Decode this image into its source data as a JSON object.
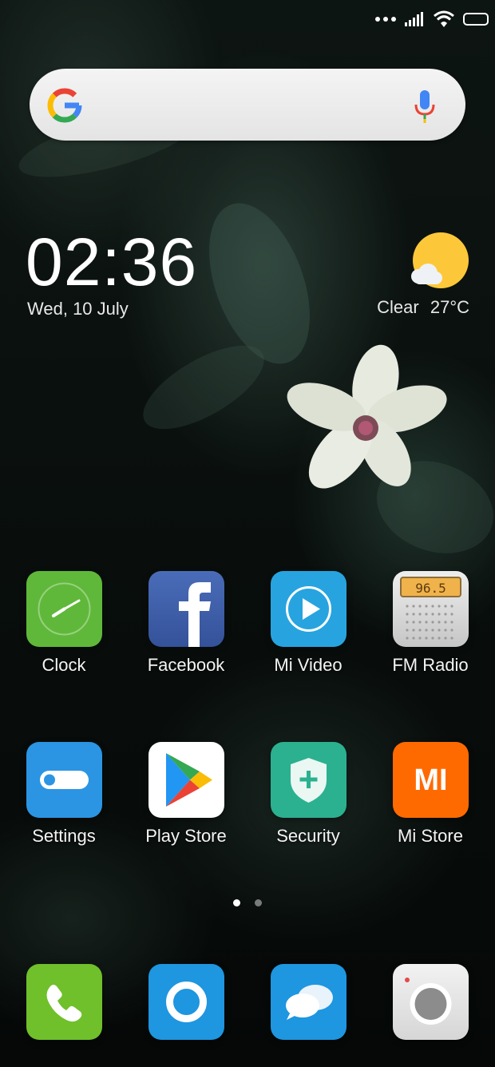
{
  "status_bar": {
    "signal_icon": "signal-icon",
    "wifi_icon": "wifi-icon",
    "battery_icon": "battery-icon"
  },
  "search_bar": {
    "logo_icon": "google-g-icon",
    "mic_icon": "microphone-icon"
  },
  "clock_widget": {
    "time": "02:36",
    "date": "Wed, 10 July"
  },
  "weather_widget": {
    "condition": "Clear",
    "temperature": "27°C",
    "icon": "sun-cloud-icon"
  },
  "apps": [
    {
      "label": "Clock",
      "icon": "clock-icon",
      "color": "#5fb83a"
    },
    {
      "label": "Facebook",
      "icon": "facebook-icon",
      "color": "#3b5ba5"
    },
    {
      "label": "Mi Video",
      "icon": "play-icon",
      "color": "#27a4e0"
    },
    {
      "label": "FM Radio",
      "icon": "radio-icon",
      "color": "#d8d8d8",
      "display_text": "96.5"
    },
    {
      "label": "Settings",
      "icon": "toggle-icon",
      "color": "#2b95e3"
    },
    {
      "label": "Play Store",
      "icon": "play-store-icon",
      "color": "#ffffff"
    },
    {
      "label": "Security",
      "icon": "shield-plus-icon",
      "color": "#2bb18f"
    },
    {
      "label": "Mi Store",
      "icon": "mi-logo-icon",
      "color": "#ff6a00",
      "logo_text": "MI"
    }
  ],
  "page_indicator": {
    "pages": 2,
    "current": 1
  },
  "dock": [
    {
      "icon": "phone-icon",
      "color": "#6fc02a"
    },
    {
      "icon": "browser-ring-icon",
      "color": "#1e96e0"
    },
    {
      "icon": "messages-icon",
      "color": "#1e96e0"
    },
    {
      "icon": "camera-icon",
      "color": "#e6e6e6"
    }
  ]
}
